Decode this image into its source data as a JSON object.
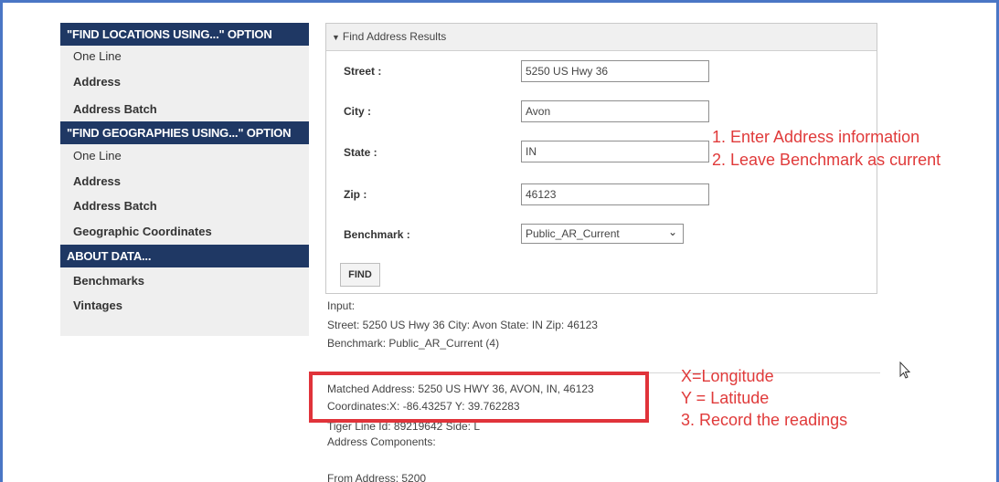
{
  "sidebar": {
    "sections": [
      {
        "header": "\"FIND LOCATIONS USING...\" OPTION",
        "items": [
          "One Line",
          "Address",
          "Address Batch"
        ]
      },
      {
        "header": "\"FIND GEOGRAPHIES USING...\" OPTION",
        "items": [
          "One Line",
          "Address",
          "Address Batch",
          "Geographic Coordinates"
        ]
      },
      {
        "header": "ABOUT DATA...",
        "items": [
          "Benchmarks",
          "Vintages"
        ]
      }
    ]
  },
  "panel": {
    "title": "Find Address Results",
    "street_label": "Street :",
    "street_value": "5250 US Hwy 36",
    "city_label": "City :",
    "city_value": "Avon",
    "state_label": "State :",
    "state_value": "IN",
    "zip_label": "Zip :",
    "zip_value": "46123",
    "benchmark_label": "Benchmark :",
    "benchmark_value": "Public_AR_Current",
    "find_button": "FIND"
  },
  "output": {
    "input_label": "Input:",
    "input_line": "Street: 5250 US Hwy 36 City: Avon State: IN Zip: 46123",
    "benchmark_line": "Benchmark: Public_AR_Current (4)",
    "matched_address": "Matched Address: 5250 US HWY 36, AVON, IN, 46123",
    "coordinates": "Coordinates:X: -86.43257 Y: 39.762283",
    "tiger_line": "Tiger Line Id: 89219642 Side: L",
    "components_label": "Address Components:",
    "from_address": "From Address: 5200"
  },
  "annotations": {
    "step1": "1. Enter Address information",
    "step2": "2.  Leave Benchmark as current",
    "x_note": "X=Longitude",
    "y_note": "Y = Latitude",
    "step3": "3. Record the readings"
  },
  "colors": {
    "sidebar_header": "#1f3864",
    "frame_border": "#4a76c5",
    "annotation_red": "#e03a3a"
  }
}
